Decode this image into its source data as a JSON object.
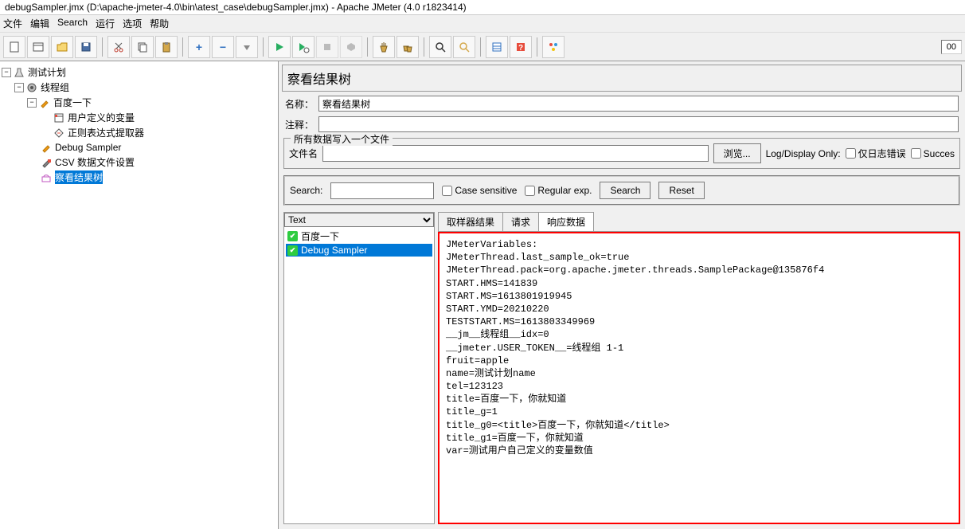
{
  "window": {
    "title": "debugSampler.jmx (D:\\apache-jmeter-4.0\\bin\\atest_case\\debugSampler.jmx) - Apache JMeter (4.0 r1823414)"
  },
  "menu": [
    "文件",
    "编辑",
    "Search",
    "运行",
    "选项",
    "帮助"
  ],
  "toolbar_counter": "00",
  "tree": {
    "root": "测试计划",
    "thread_group": "线程组",
    "items": [
      "百度一下",
      "用户定义的变量",
      "正则表达式提取器",
      "Debug Sampler",
      "CSV 数据文件设置",
      "察看结果树"
    ]
  },
  "panel": {
    "header": "察看结果树",
    "name_label": "名称：",
    "name_value": "察看结果树",
    "comment_label": "注释：",
    "fieldset_legend": "所有数据写入一个文件",
    "filename_label": "文件名",
    "browse_btn": "浏览...",
    "logdisplay_label": "Log/Display Only:",
    "errors_only": "仅日志错误",
    "success_only": "Succes"
  },
  "search": {
    "label": "Search:",
    "case": "Case sensitive",
    "regex": "Regular exp.",
    "search_btn": "Search",
    "reset_btn": "Reset"
  },
  "results": {
    "renderer": "Text",
    "items": [
      "百度一下",
      "Debug Sampler"
    ],
    "selected": 1
  },
  "tabs": [
    "取样器结果",
    "请求",
    "响应数据"
  ],
  "active_tab": 2,
  "response_body": "JMeterVariables:\nJMeterThread.last_sample_ok=true\nJMeterThread.pack=org.apache.jmeter.threads.SamplePackage@135876f4\nSTART.HMS=141839\nSTART.MS=1613801919945\nSTART.YMD=20210220\nTESTSTART.MS=1613803349969\n__jm__线程组__idx=0\n__jmeter.USER_TOKEN__=线程组 1-1\nfruit=apple\nname=测试计划name\ntel=123123\ntitle=百度一下，你就知道\ntitle_g=1\ntitle_g0=<title>百度一下，你就知道</title>\ntitle_g1=百度一下，你就知道\nvar=测试用户自己定义的变量数值"
}
